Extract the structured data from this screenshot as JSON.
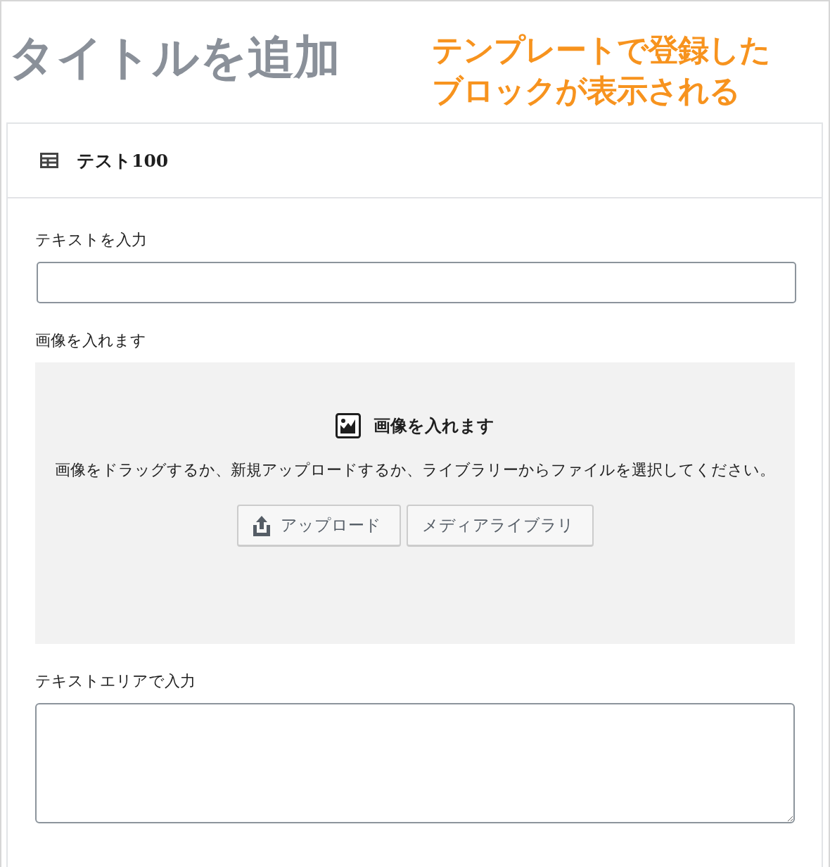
{
  "title_field": {
    "placeholder": "タイトルを追加"
  },
  "annotation": [
    "テンプレートで登録した",
    "ブロックが表示される"
  ],
  "block": {
    "title": "テスト100",
    "fields": [
      {
        "kind": "text",
        "label": "テキストを入力"
      },
      {
        "kind": "image",
        "label": "画像を入れます",
        "placeholder_title": "画像を入れます",
        "instructions": "画像をドラッグするか、新規アップロードするか、ライブラリーからファイルを選択してください。",
        "buttons": [
          "アップロード",
          "メディアライブラリ"
        ]
      },
      {
        "kind": "textarea",
        "label": "テキストエリアで入力"
      }
    ]
  }
}
